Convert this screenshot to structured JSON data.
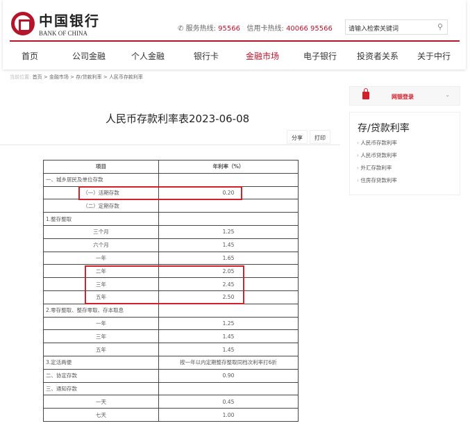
{
  "header": {
    "logo_cn": "中国银行",
    "logo_en": "BANK OF CHINA",
    "service_label": "服务热线:",
    "service_number": "95566",
    "card_label": "信用卡热线:",
    "card_number": "40066 95566",
    "search_placeholder": "请输入检索关键词"
  },
  "nav": [
    "首页",
    "公司金融",
    "个人金融",
    "银行卡",
    "金融市场",
    "电子银行",
    "投资者关系",
    "关于中行"
  ],
  "nav_active": "金融市场",
  "breadcrumb": {
    "prefix": "当前位置:",
    "items": [
      "首页",
      "金融市场",
      "存/贷款利率",
      "人民币存款利率"
    ]
  },
  "page_title": "人民币存款利率表2023-06-08",
  "actions": {
    "share": "分享",
    "print": "打印"
  },
  "sidebar": {
    "login": "网银登录",
    "section_title": "存/贷款利率",
    "links": [
      "人民币存款利率",
      "人民币贷款利率",
      "外汇存款利率",
      "住房存贷款利率"
    ]
  },
  "table": {
    "headers": [
      "项目",
      "年利率（%）"
    ],
    "rows": [
      [
        "一、城乡居民及单位存款",
        ""
      ],
      [
        "（一）活期存款",
        "0.20"
      ],
      [
        "（二）定期存款",
        ""
      ],
      [
        "1.整存整取",
        ""
      ],
      [
        "三个月",
        "1.25"
      ],
      [
        "六个月",
        "1.45"
      ],
      [
        "一年",
        "1.65"
      ],
      [
        "二年",
        "2.05"
      ],
      [
        "三年",
        "2.45"
      ],
      [
        "五年",
        "2.50"
      ],
      [
        "2.零存整取、整存零取、存本取息",
        ""
      ],
      [
        "一年",
        "1.25"
      ],
      [
        "三年",
        "1.45"
      ],
      [
        "五年",
        "1.45"
      ],
      [
        "3.定活两便",
        "按一年以内定期整存整取同档次利率打6折"
      ],
      [
        "二、协定存款",
        "0.90"
      ],
      [
        "三、通知存款",
        ""
      ],
      [
        "一天",
        "0.45"
      ],
      [
        "七天",
        "1.00"
      ]
    ],
    "left_aligned_rows": [
      0,
      3,
      10,
      14,
      15,
      16
    ]
  },
  "colors": {
    "brand": "#b5152b",
    "highlight": "#d0202a"
  }
}
